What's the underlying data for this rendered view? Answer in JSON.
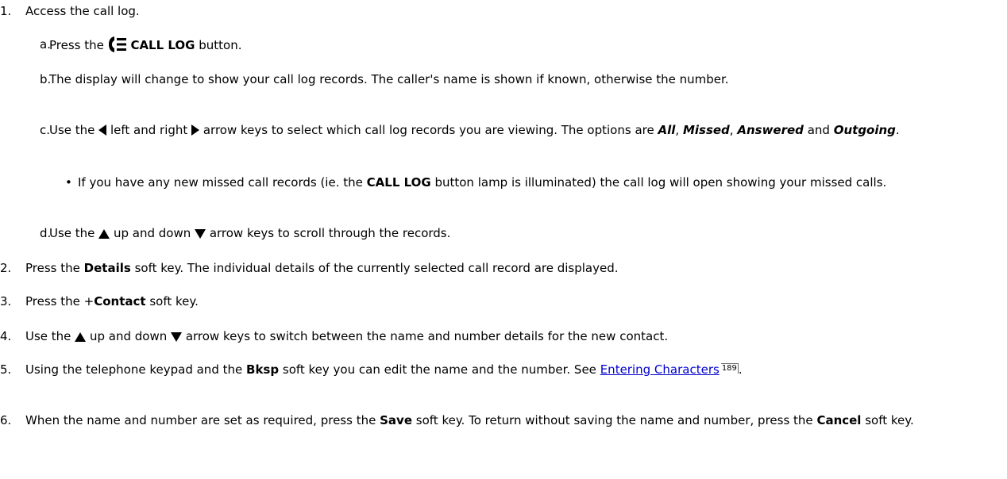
{
  "steps": [
    {
      "num": "1.",
      "text": "Access the call log."
    },
    {
      "num": "a.",
      "pre": "Press the",
      "bold": "CALL LOG",
      "post": "button."
    },
    {
      "num": "b.",
      "text": "The display will change to show your call log records. The caller's name is shown if known, otherwise the number."
    },
    {
      "num": "c.",
      "pre": "Use the",
      "mid1": "left and right",
      "mid2": "arrow keys to select which call log records you are viewing. The options are",
      "opt1": "All",
      "sep1": ",",
      "opt2": "Missed",
      "sep2": ",",
      "opt3": "Answered",
      "sep3": "and",
      "opt4": "Outgoing",
      "end": "."
    },
    {
      "pre": "If you have any new missed call records (ie. the",
      "bold": "CALL LOG",
      "post": "button lamp is illuminated) the call log will open showing your missed calls."
    },
    {
      "num": "d.",
      "pre": "Use the",
      "mid": "up and down",
      "post": "arrow keys to scroll through the records."
    },
    {
      "num": "2.",
      "pre": "Press the",
      "bold": "Details",
      "post": "soft key. The individual details of the currently selected call record are displayed."
    },
    {
      "num": "3.",
      "pre": "Press the +",
      "bold": "Contact",
      "post": "soft key."
    },
    {
      "num": "4.",
      "pre": "Use the",
      "mid": "up and down",
      "post": "arrow keys to switch between the name and number details for the new contact."
    },
    {
      "num": "5.",
      "pre": "Using the telephone keypad and the",
      "bold": "Bksp",
      "post": "soft key you can edit the name and the number. See",
      "link": "Entering Characters",
      "page_ref": "189",
      "end": "."
    },
    {
      "num": "6.",
      "pre": "When the name and number are set as required, press the",
      "bold1": "Save",
      "mid": "soft key. To return without saving the name and number, press the",
      "bold2": "Cancel",
      "post": "soft key."
    }
  ],
  "icons": [
    "call-log-icon",
    "left-arrow-icon",
    "right-arrow-icon",
    "up-arrow-icon",
    "down-arrow-icon"
  ]
}
